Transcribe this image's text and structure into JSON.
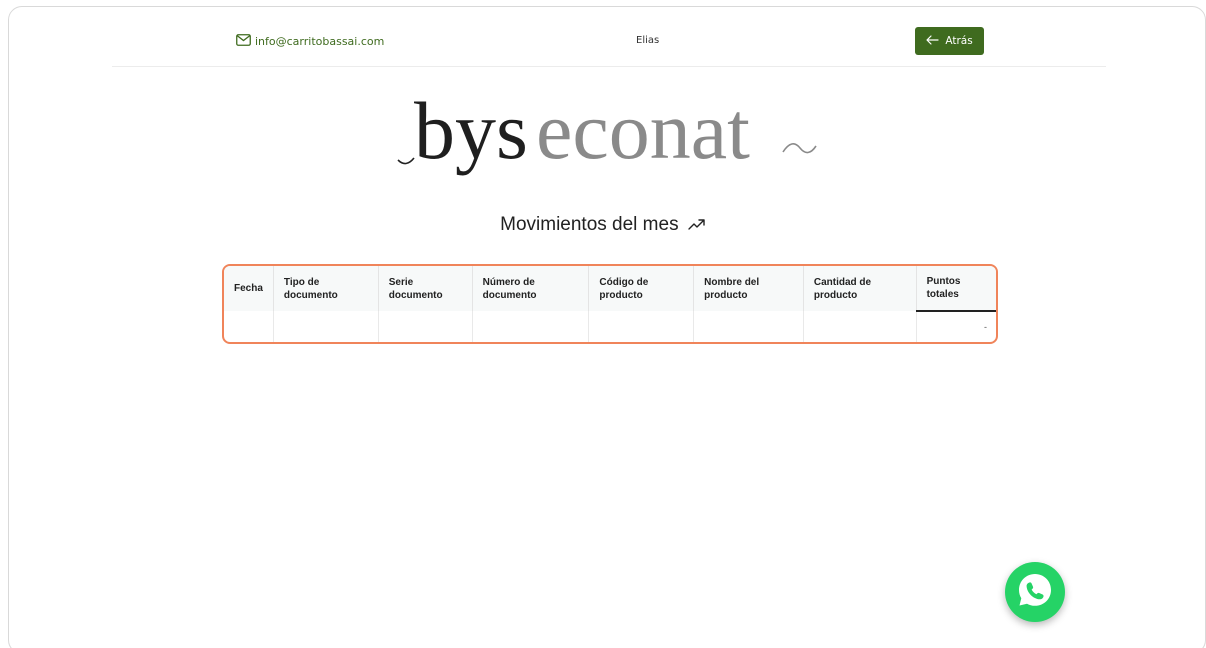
{
  "header": {
    "email": "info@carritobassai.com",
    "user_name": "Elias",
    "back_label": "Atrás"
  },
  "logo": {
    "text_part1": "bys",
    "text_part2": "econat"
  },
  "section": {
    "title": "Movimientos del mes"
  },
  "table": {
    "columns": [
      "Fecha",
      "Tipo de documento",
      "Serie documento",
      "Número de documento",
      "Código de producto",
      "Nombre del producto",
      "Cantidad de producto",
      "Puntos totales"
    ],
    "row": {
      "total_points": "-"
    }
  },
  "colors": {
    "brand_green": "#3f6b1f",
    "table_border": "#f0845a",
    "whatsapp_green": "#25d366"
  },
  "icons": {
    "email": "mail-icon",
    "back": "arrow-left-icon",
    "trend": "trending-up-icon",
    "whatsapp": "whatsapp-icon"
  }
}
